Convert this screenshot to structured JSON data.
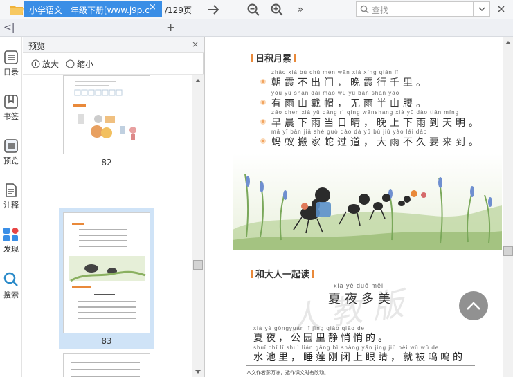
{
  "toolbar": {
    "page_current": "83",
    "page_total": "/129页",
    "search_placeholder": "查找"
  },
  "tabs": {
    "active_label": "小学语文一年级下册[www.j9p.c",
    "close": "×",
    "add": "+"
  },
  "left_nav": {
    "items": [
      {
        "label": "目录"
      },
      {
        "label": "书签"
      },
      {
        "label": "预览"
      },
      {
        "label": "注释"
      },
      {
        "label": "发现"
      },
      {
        "label": "搜索"
      }
    ]
  },
  "preview_panel": {
    "title": "预览",
    "close": "×",
    "zoom_in": "放大",
    "zoom_out": "缩小",
    "thumbnails": [
      {
        "page": "82"
      },
      {
        "page": "83"
      }
    ]
  },
  "document": {
    "section1_title": "日积月累",
    "lines": [
      {
        "pinyin": "zhāo xiá bù chū mén      wǎn xiá xíng qiān lǐ",
        "text": "朝霞不出门，晚霞行千里。"
      },
      {
        "pinyin": "yǒu yǔ shān dài mào      wú yǔ bàn shān yāo",
        "text": "有雨山戴帽，无雨半山腰。"
      },
      {
        "pinyin": "zǎo chen xià yǔ dāng rì qíng      wǎnshang xià yǔ dào tiān míng",
        "text": "早晨下雨当日晴，晚上下雨到天明。"
      },
      {
        "pinyin": "mǎ yǐ bān jiā shé guò dào      dà yǔ bù jiǔ yào lái dào",
        "text": "蚂蚁搬家蛇过道，大雨不久要来到。"
      }
    ],
    "section2_title": "和大人一起读",
    "poem_title_pinyin": "xià  yè  duō  měi",
    "poem_title": "夏夜多美",
    "para1_pinyin": "xià  yè      gōngyuán  lǐ  jìng qiāo qiāo de",
    "para1": "夏夜，公园里静悄悄的。",
    "para2_pinyin": "shuǐ chí lǐ      shuì lián gāng bì shàng yǎn jing      jiù bèi wū wū de",
    "para2": "水池里，睡莲刚闭上眼睛，就被呜呜的",
    "footnote": "本文作者彭万洲，选作课文时有改动。",
    "watermark": "人 教 版"
  },
  "colors": {
    "accent": "#3a8ee6",
    "orange": "#e9893a"
  }
}
